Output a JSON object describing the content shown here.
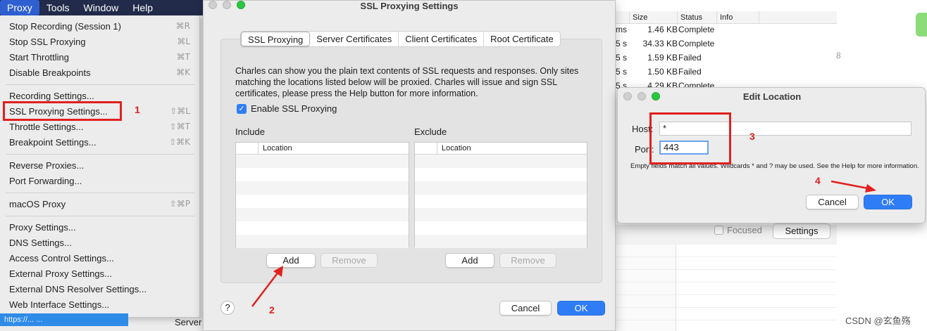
{
  "menubar": {
    "items": [
      "Proxy",
      "Tools",
      "Window",
      "Help"
    ],
    "active": "Proxy"
  },
  "proxy_menu": {
    "items": [
      {
        "label": "Stop Recording (Session 1)",
        "shortcut": "⌘R"
      },
      {
        "label": "Stop SSL Proxying",
        "shortcut": "⌘L"
      },
      {
        "label": "Start Throttling",
        "shortcut": "⌘T"
      },
      {
        "label": "Disable Breakpoints",
        "shortcut": "⌘K"
      },
      {
        "label": "Recording Settings...",
        "shortcut": ""
      },
      {
        "label": "SSL Proxying Settings...",
        "shortcut": "⇧⌘L"
      },
      {
        "label": "Throttle Settings...",
        "shortcut": "⇧⌘T"
      },
      {
        "label": "Breakpoint Settings...",
        "shortcut": "⇧⌘K"
      },
      {
        "label": "Reverse Proxies...",
        "shortcut": ""
      },
      {
        "label": "Port Forwarding...",
        "shortcut": ""
      },
      {
        "label": "macOS Proxy",
        "shortcut": "⇧⌘P"
      },
      {
        "label": "Proxy Settings...",
        "shortcut": ""
      },
      {
        "label": "DNS Settings...",
        "shortcut": ""
      },
      {
        "label": "Access Control Settings...",
        "shortcut": ""
      },
      {
        "label": "External Proxy Settings...",
        "shortcut": ""
      },
      {
        "label": "External DNS Resolver Settings...",
        "shortcut": ""
      },
      {
        "label": "Web Interface Settings...",
        "shortcut": ""
      }
    ],
    "url_fragment": "https://...  ...",
    "server_label": "Server"
  },
  "ssl_dialog": {
    "title": "SSL Proxying Settings",
    "tabs": [
      "SSL Proxying",
      "Server Certificates",
      "Client Certificates",
      "Root Certificate"
    ],
    "selected_tab": "SSL Proxying",
    "description": "Charles can show you the plain text contents of SSL requests and responses. Only sites matching the locations listed below will be proxied. Charles will issue and sign SSL certificates, please press the Help button for more information.",
    "enable_label": "Enable SSL Proxying",
    "include_label": "Include",
    "exclude_label": "Exclude",
    "location_col": "Location",
    "add_label": "Add",
    "remove_label": "Remove",
    "help_label": "?",
    "cancel_label": "Cancel",
    "ok_label": "OK"
  },
  "edit_dialog": {
    "title": "Edit Location",
    "host_label": "Host:",
    "host_value": "*",
    "port_label": "Port:",
    "port_value": "443",
    "hint": "Empty fields match all values. Wildcards * and ? may be used. See the Help for more information.",
    "cancel_label": "Cancel",
    "ok_label": "OK"
  },
  "background_table": {
    "columns": [
      "Size",
      "Status",
      "Info"
    ],
    "rows": [
      {
        "time": "ms",
        "size": "1.46 KB",
        "status": "Complete"
      },
      {
        "time": "5 s",
        "size": "34.33 KB",
        "status": "Complete"
      },
      {
        "time": "5 s",
        "size": "1.59 KB",
        "status": "Failed"
      },
      {
        "time": "5 s",
        "size": "1.50 KB",
        "status": "Failed"
      },
      {
        "time": "5 s",
        "size": "4.29 KB",
        "status": "Complete"
      }
    ],
    "focused_label": "Focused",
    "settings_label": "Settings",
    "side_number": "8"
  },
  "annotations": {
    "n1": "1",
    "n2": "2",
    "n3": "3",
    "n4": "4"
  },
  "watermark": "CSDN @玄鱼殇",
  "colors": {
    "accent": "#2f7df6",
    "annotation": "#e0201f",
    "menubar": "#222b4a"
  }
}
